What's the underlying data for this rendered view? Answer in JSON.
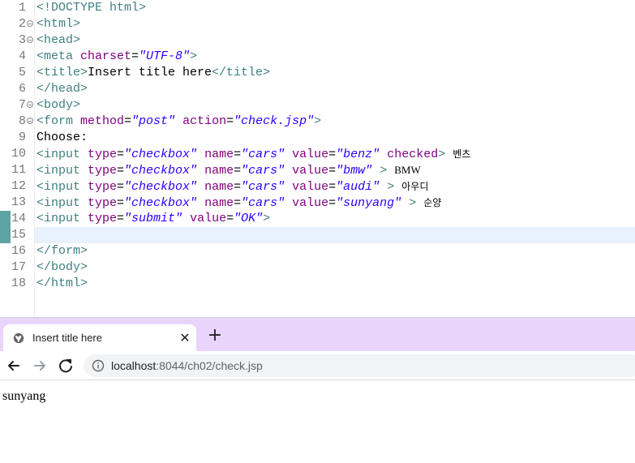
{
  "editor": {
    "lines": [
      {
        "num": "1",
        "fold": false,
        "changed": false,
        "current": false,
        "tokens": [
          {
            "t": "tag",
            "v": "<!DOCTYPE html>"
          }
        ]
      },
      {
        "num": "2",
        "fold": true,
        "changed": false,
        "current": false,
        "tokens": [
          {
            "t": "tag",
            "v": "<html>"
          }
        ]
      },
      {
        "num": "3",
        "fold": true,
        "changed": false,
        "current": false,
        "tokens": [
          {
            "t": "tag",
            "v": "<head>"
          }
        ]
      },
      {
        "num": "4",
        "fold": false,
        "changed": false,
        "current": false,
        "tokens": [
          {
            "t": "tag",
            "v": "<meta "
          },
          {
            "t": "attr",
            "v": "charset"
          },
          {
            "t": "txt",
            "v": "="
          },
          {
            "t": "val",
            "v": "\"UTF-8\""
          },
          {
            "t": "tag",
            "v": ">"
          }
        ]
      },
      {
        "num": "5",
        "fold": false,
        "changed": false,
        "current": false,
        "tokens": [
          {
            "t": "tag",
            "v": "<title>"
          },
          {
            "t": "txt",
            "v": "Insert title here"
          },
          {
            "t": "tag",
            "v": "</title>"
          }
        ]
      },
      {
        "num": "6",
        "fold": false,
        "changed": false,
        "current": false,
        "tokens": [
          {
            "t": "tag",
            "v": "</head>"
          }
        ]
      },
      {
        "num": "7",
        "fold": true,
        "changed": false,
        "current": false,
        "tokens": [
          {
            "t": "tag",
            "v": "<body>"
          }
        ]
      },
      {
        "num": "8",
        "fold": true,
        "changed": false,
        "current": false,
        "tokens": [
          {
            "t": "tag",
            "v": "<form "
          },
          {
            "t": "attr",
            "v": "method"
          },
          {
            "t": "txt",
            "v": "="
          },
          {
            "t": "val",
            "v": "\"post\""
          },
          {
            "t": "txt",
            "v": " "
          },
          {
            "t": "attr",
            "v": "action"
          },
          {
            "t": "txt",
            "v": "="
          },
          {
            "t": "val",
            "v": "\"check.jsp\""
          },
          {
            "t": "tag",
            "v": ">"
          }
        ]
      },
      {
        "num": "9",
        "fold": false,
        "changed": false,
        "current": false,
        "tokens": [
          {
            "t": "txt",
            "v": "Choose:"
          }
        ]
      },
      {
        "num": "10",
        "fold": false,
        "changed": false,
        "current": false,
        "tokens": [
          {
            "t": "tag",
            "v": "<input "
          },
          {
            "t": "attr",
            "v": "type"
          },
          {
            "t": "txt",
            "v": "="
          },
          {
            "t": "val",
            "v": "\"checkbox\""
          },
          {
            "t": "txt",
            "v": " "
          },
          {
            "t": "attr",
            "v": "name"
          },
          {
            "t": "txt",
            "v": "="
          },
          {
            "t": "val",
            "v": "\"cars\""
          },
          {
            "t": "txt",
            "v": " "
          },
          {
            "t": "attr",
            "v": "value"
          },
          {
            "t": "txt",
            "v": "="
          },
          {
            "t": "val",
            "v": "\"benz\""
          },
          {
            "t": "txt",
            "v": " "
          },
          {
            "t": "attr",
            "v": "checked"
          },
          {
            "t": "tag",
            "v": ">"
          },
          {
            "t": "txt",
            "v": " "
          },
          {
            "t": "kor",
            "v": "벤츠"
          }
        ]
      },
      {
        "num": "11",
        "fold": false,
        "changed": false,
        "current": false,
        "tokens": [
          {
            "t": "tag",
            "v": "<input "
          },
          {
            "t": "attr",
            "v": "type"
          },
          {
            "t": "txt",
            "v": "="
          },
          {
            "t": "val",
            "v": "\"checkbox\""
          },
          {
            "t": "txt",
            "v": " "
          },
          {
            "t": "attr",
            "v": "name"
          },
          {
            "t": "txt",
            "v": "="
          },
          {
            "t": "val",
            "v": "\"cars\""
          },
          {
            "t": "txt",
            "v": " "
          },
          {
            "t": "attr",
            "v": "value"
          },
          {
            "t": "txt",
            "v": "="
          },
          {
            "t": "val",
            "v": "\"bmw\""
          },
          {
            "t": "txt",
            "v": " "
          },
          {
            "t": "tag",
            "v": ">"
          },
          {
            "t": "txt",
            "v": " "
          },
          {
            "t": "latin",
            "v": "BMW"
          }
        ]
      },
      {
        "num": "12",
        "fold": false,
        "changed": false,
        "current": false,
        "tokens": [
          {
            "t": "tag",
            "v": "<input "
          },
          {
            "t": "attr",
            "v": "type"
          },
          {
            "t": "txt",
            "v": "="
          },
          {
            "t": "val",
            "v": "\"checkbox\""
          },
          {
            "t": "txt",
            "v": " "
          },
          {
            "t": "attr",
            "v": "name"
          },
          {
            "t": "txt",
            "v": "="
          },
          {
            "t": "val",
            "v": "\"cars\""
          },
          {
            "t": "txt",
            "v": " "
          },
          {
            "t": "attr",
            "v": "value"
          },
          {
            "t": "txt",
            "v": "="
          },
          {
            "t": "val",
            "v": "\"audi\""
          },
          {
            "t": "txt",
            "v": " "
          },
          {
            "t": "tag",
            "v": ">"
          },
          {
            "t": "txt",
            "v": " "
          },
          {
            "t": "kor",
            "v": "아우디"
          }
        ]
      },
      {
        "num": "13",
        "fold": false,
        "changed": false,
        "current": false,
        "tokens": [
          {
            "t": "tag",
            "v": "<input "
          },
          {
            "t": "attr",
            "v": "type"
          },
          {
            "t": "txt",
            "v": "="
          },
          {
            "t": "val",
            "v": "\"checkbox\""
          },
          {
            "t": "txt",
            "v": " "
          },
          {
            "t": "attr",
            "v": "name"
          },
          {
            "t": "txt",
            "v": "="
          },
          {
            "t": "val",
            "v": "\"cars\""
          },
          {
            "t": "txt",
            "v": " "
          },
          {
            "t": "attr",
            "v": "value"
          },
          {
            "t": "txt",
            "v": "="
          },
          {
            "t": "val",
            "v": "\"sunyang\""
          },
          {
            "t": "txt",
            "v": " "
          },
          {
            "t": "tag",
            "v": ">"
          },
          {
            "t": "txt",
            "v": " "
          },
          {
            "t": "kor",
            "v": "순양"
          }
        ]
      },
      {
        "num": "14",
        "fold": false,
        "changed": true,
        "current": false,
        "tokens": [
          {
            "t": "tag",
            "v": "<input "
          },
          {
            "t": "attr",
            "v": "type"
          },
          {
            "t": "txt",
            "v": "="
          },
          {
            "t": "val",
            "v": "\"submit\""
          },
          {
            "t": "txt",
            "v": " "
          },
          {
            "t": "attr",
            "v": "value"
          },
          {
            "t": "txt",
            "v": "="
          },
          {
            "t": "val",
            "v": "\"OK\""
          },
          {
            "t": "tag",
            "v": ">"
          }
        ]
      },
      {
        "num": "15",
        "fold": false,
        "changed": true,
        "current": true,
        "tokens": []
      },
      {
        "num": "16",
        "fold": false,
        "changed": false,
        "current": false,
        "tokens": [
          {
            "t": "tag",
            "v": "</form>"
          }
        ]
      },
      {
        "num": "17",
        "fold": false,
        "changed": false,
        "current": false,
        "tokens": [
          {
            "t": "tag",
            "v": "</body>"
          }
        ]
      },
      {
        "num": "18",
        "fold": false,
        "changed": false,
        "current": false,
        "tokens": [
          {
            "t": "tag",
            "v": "</html>"
          }
        ]
      }
    ],
    "colors": {
      "tag": "#3f7f7f",
      "attr": "#7f007f",
      "value": "#2a00ff",
      "current_line": "#e8f2fe",
      "change_bar": "#5fa3a3"
    }
  },
  "browser": {
    "tab": {
      "title": "Insert title here",
      "favicon": "globe-icon",
      "close_label": "✕"
    },
    "new_tab_label": "+",
    "toolbar": {
      "back": "back-arrow-icon",
      "forward": "forward-arrow-icon",
      "reload": "reload-icon"
    },
    "address": {
      "host": "localhost",
      "rest": ":8044/ch02/check.jsp",
      "icon": "info-icon"
    },
    "page": {
      "text": "sunyang"
    },
    "colors": {
      "tabstrip": "#e9d5fb",
      "omnibox": "#f1f3f4"
    }
  }
}
